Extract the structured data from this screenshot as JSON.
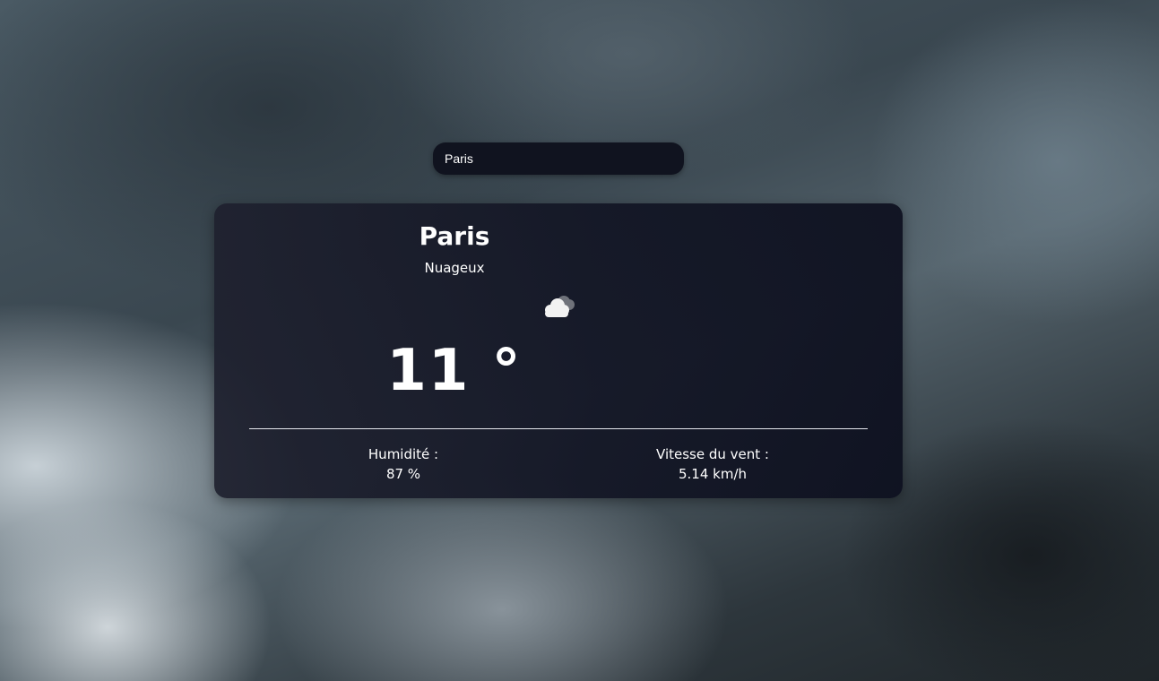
{
  "search": {
    "value": "Paris"
  },
  "weather": {
    "city": "Paris",
    "condition": "Nuageux",
    "icon": "cloud-icon",
    "temperature": "11 °"
  },
  "stats": {
    "humidity_label": "Humidité :",
    "humidity_value": "87 %",
    "wind_label": "Vitesse du vent :",
    "wind_value": "5.14 km/h"
  },
  "colors": {
    "card_background": "#121524",
    "search_background": "#10131f",
    "text": "#ffffff"
  }
}
